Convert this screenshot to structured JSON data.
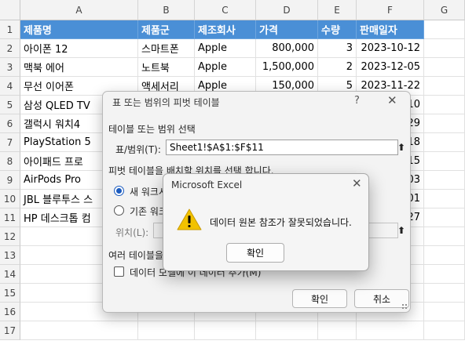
{
  "spreadsheet": {
    "columns": [
      "A",
      "B",
      "C",
      "D",
      "E",
      "F",
      "G"
    ],
    "row_numbers": [
      "1",
      "2",
      "3",
      "4",
      "5",
      "6",
      "7",
      "8",
      "9",
      "10",
      "11",
      "12",
      "13",
      "14",
      "15",
      "16",
      "17"
    ],
    "header": [
      "제품명",
      "제품군",
      "제조회사",
      "가격",
      "수량",
      "판매일자"
    ],
    "rows": [
      [
        "아이폰 12",
        "스마트폰",
        "Apple",
        "800,000",
        "3",
        "2023-10-12"
      ],
      [
        "맥북 에어",
        "노트북",
        "Apple",
        "1,500,000",
        "2",
        "2023-12-05"
      ],
      [
        "무선 이어폰",
        "액세서리",
        "Apple",
        "150,000",
        "5",
        "2023-11-22"
      ],
      [
        "삼성 QLED TV",
        "",
        "",
        "",
        "",
        "10"
      ],
      [
        "갤럭시 워치4",
        "",
        "",
        "",
        "",
        "29"
      ],
      [
        "PlayStation 5",
        "",
        "",
        "",
        "",
        "18"
      ],
      [
        "아이패드 프로",
        "",
        "",
        "",
        "",
        "15"
      ],
      [
        "AirPods Pro",
        "",
        "",
        "",
        "",
        "03"
      ],
      [
        "JBL 블루투스 스",
        "",
        "",
        "",
        "",
        "01"
      ],
      [
        "HP 데스크톱 컴",
        "",
        "",
        "",
        "",
        "27"
      ]
    ],
    "header_color": "#4a8fd6"
  },
  "pivot_dialog": {
    "title": "표 또는 범위의 피벗 테이블",
    "help": "?",
    "close": "✕",
    "section1": "테이블 또는 범위 선택",
    "range_label": "표/범위(T):",
    "range_value": "Sheet1!$A$1:$F$11",
    "section2": "피벗 테이블을 배치할 위치를 선택 합니다.",
    "radio_new": "새 워크시",
    "radio_existing": "기존 워크",
    "location_label": "위치(L):",
    "section3": "여러 테이블을",
    "checkbox_label": "데이터 모델에 이 데이터 추가(M)",
    "ok": "확인",
    "cancel": "취소"
  },
  "error_box": {
    "title": "Microsoft Excel",
    "close": "✕",
    "message": "데이터 원본 참조가 잘못되었습니다.",
    "ok": "확인",
    "icon": "warning-icon"
  }
}
